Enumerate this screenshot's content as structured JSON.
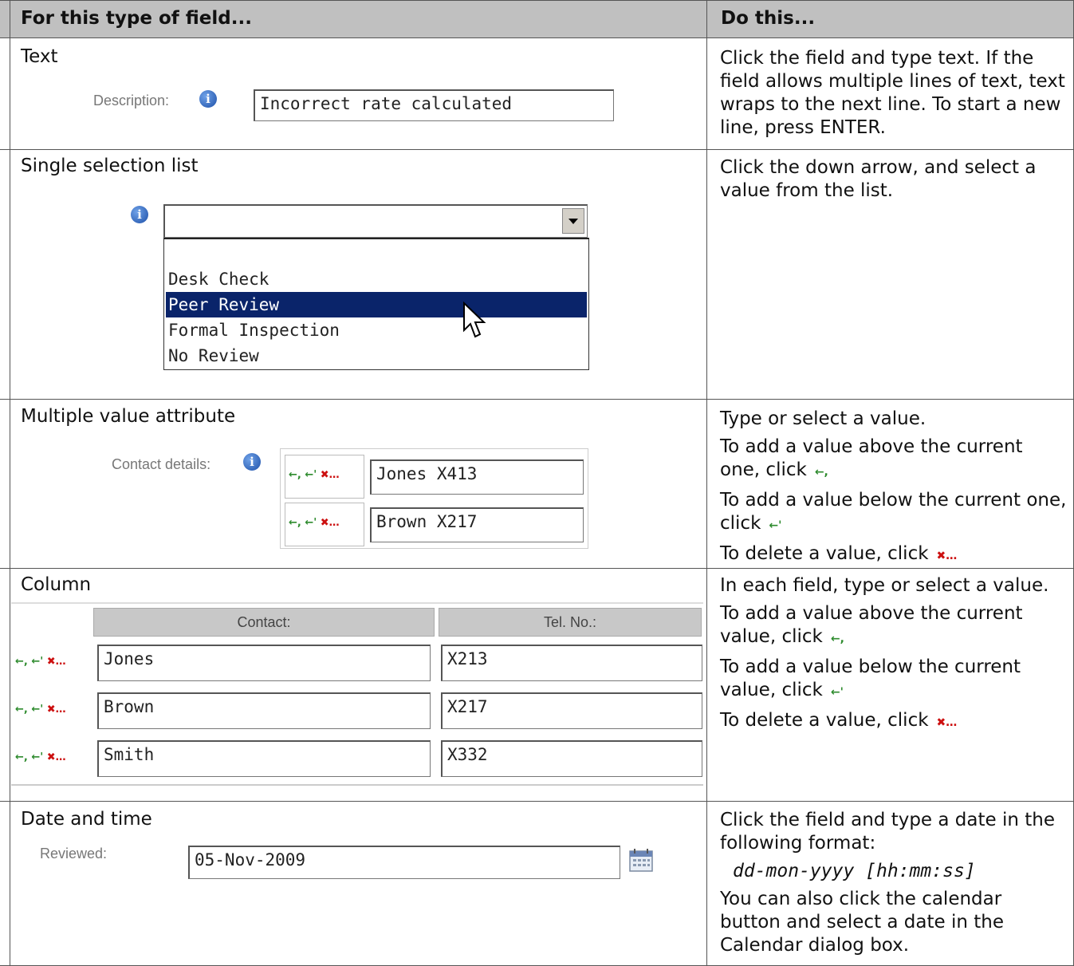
{
  "table": {
    "header_col1": "For this type of field...",
    "header_col2": "Do this..."
  },
  "rows": {
    "text": {
      "title": "Text",
      "label": "Description:",
      "value": "Incorrect rate calculated",
      "desc": [
        "Click the field and type text. If the field allows multiple lines of text, text wraps to the next line. To start a new line, press ENTER."
      ]
    },
    "single": {
      "title": "Single selection list",
      "options": [
        "Desk Check",
        "Peer Review",
        "Formal Inspection",
        "No Review"
      ],
      "selected": "Peer Review",
      "desc": [
        "Click the down arrow, and select a value from the list."
      ]
    },
    "multi": {
      "title": "Multiple value attribute",
      "label": "Contact details:",
      "values": [
        "Jones X413",
        "Brown X217"
      ],
      "desc": [
        "Type or select a value.",
        "To add a value above the current one, click",
        "To add a value below the current one, click",
        "To delete a value, click"
      ]
    },
    "column": {
      "title": "Column",
      "headers": [
        "Contact:",
        "Tel. No.:"
      ],
      "rows": [
        [
          "Jones",
          "X213"
        ],
        [
          "Brown",
          "X217"
        ],
        [
          "Smith",
          "X332"
        ]
      ],
      "desc": [
        "In each field, type or select a value.",
        "To add a value above the current value, click",
        "To add a value below the current value, click",
        "To delete a value, click"
      ]
    },
    "date": {
      "title": "Date and time",
      "label": "Reviewed:",
      "value": "05-Nov-2009",
      "desc1": "Click the field and type a date in the following format:",
      "format": "dd-mon-yyyy [hh:mm:ss]",
      "desc2": "You can also click the calendar button and select a date in the Calendar dialog box."
    }
  },
  "icons": {
    "info": "info-icon",
    "add_above": "add-above-icon",
    "add_below": "add-below-icon",
    "delete": "delete-icon",
    "calendar": "calendar-icon",
    "dropdown": "chevron-down-icon",
    "cursor": "mouse-pointer-icon"
  }
}
